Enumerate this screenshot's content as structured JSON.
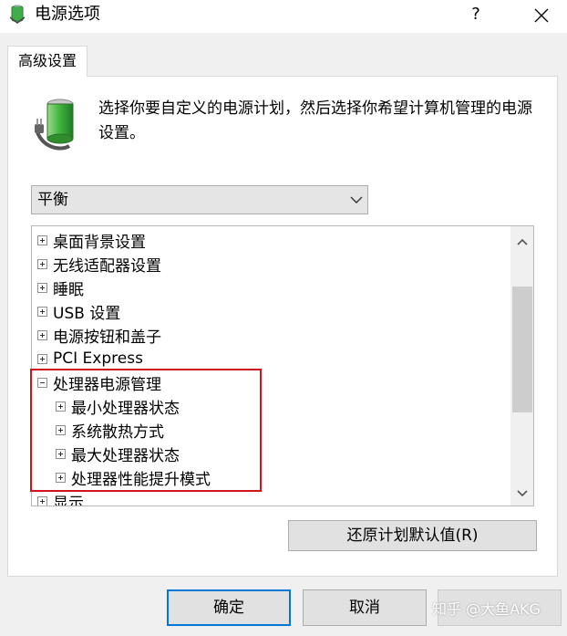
{
  "window": {
    "title": "电源选项",
    "help_label": "?"
  },
  "tab": {
    "label": "高级设置"
  },
  "description": "选择你要自定义的电源计划，然后选择你希望计算机管理的电源设置。",
  "plan_select": {
    "value": "平衡"
  },
  "tree": {
    "items": [
      {
        "label": "桌面背景设置",
        "state": "collapsed"
      },
      {
        "label": "无线适配器设置",
        "state": "collapsed"
      },
      {
        "label": "睡眠",
        "state": "collapsed"
      },
      {
        "label": "USB 设置",
        "state": "collapsed"
      },
      {
        "label": "电源按钮和盖子",
        "state": "collapsed"
      },
      {
        "label": "PCI Express",
        "state": "collapsed"
      },
      {
        "label": "处理器电源管理",
        "state": "expanded"
      },
      {
        "label": "最小处理器状态",
        "state": "collapsed"
      },
      {
        "label": "系统散热方式",
        "state": "collapsed"
      },
      {
        "label": "最大处理器状态",
        "state": "collapsed"
      },
      {
        "label": "处理器性能提升模式",
        "state": "collapsed"
      },
      {
        "label": "显示",
        "state": "collapsed"
      }
    ]
  },
  "buttons": {
    "restore": "还原计划默认值(R)",
    "ok": "确定",
    "cancel": "取消"
  },
  "watermark": "知乎 @大鱼AKG",
  "colors": {
    "highlight": "#d0141b",
    "default_button_border": "#0078d7"
  }
}
